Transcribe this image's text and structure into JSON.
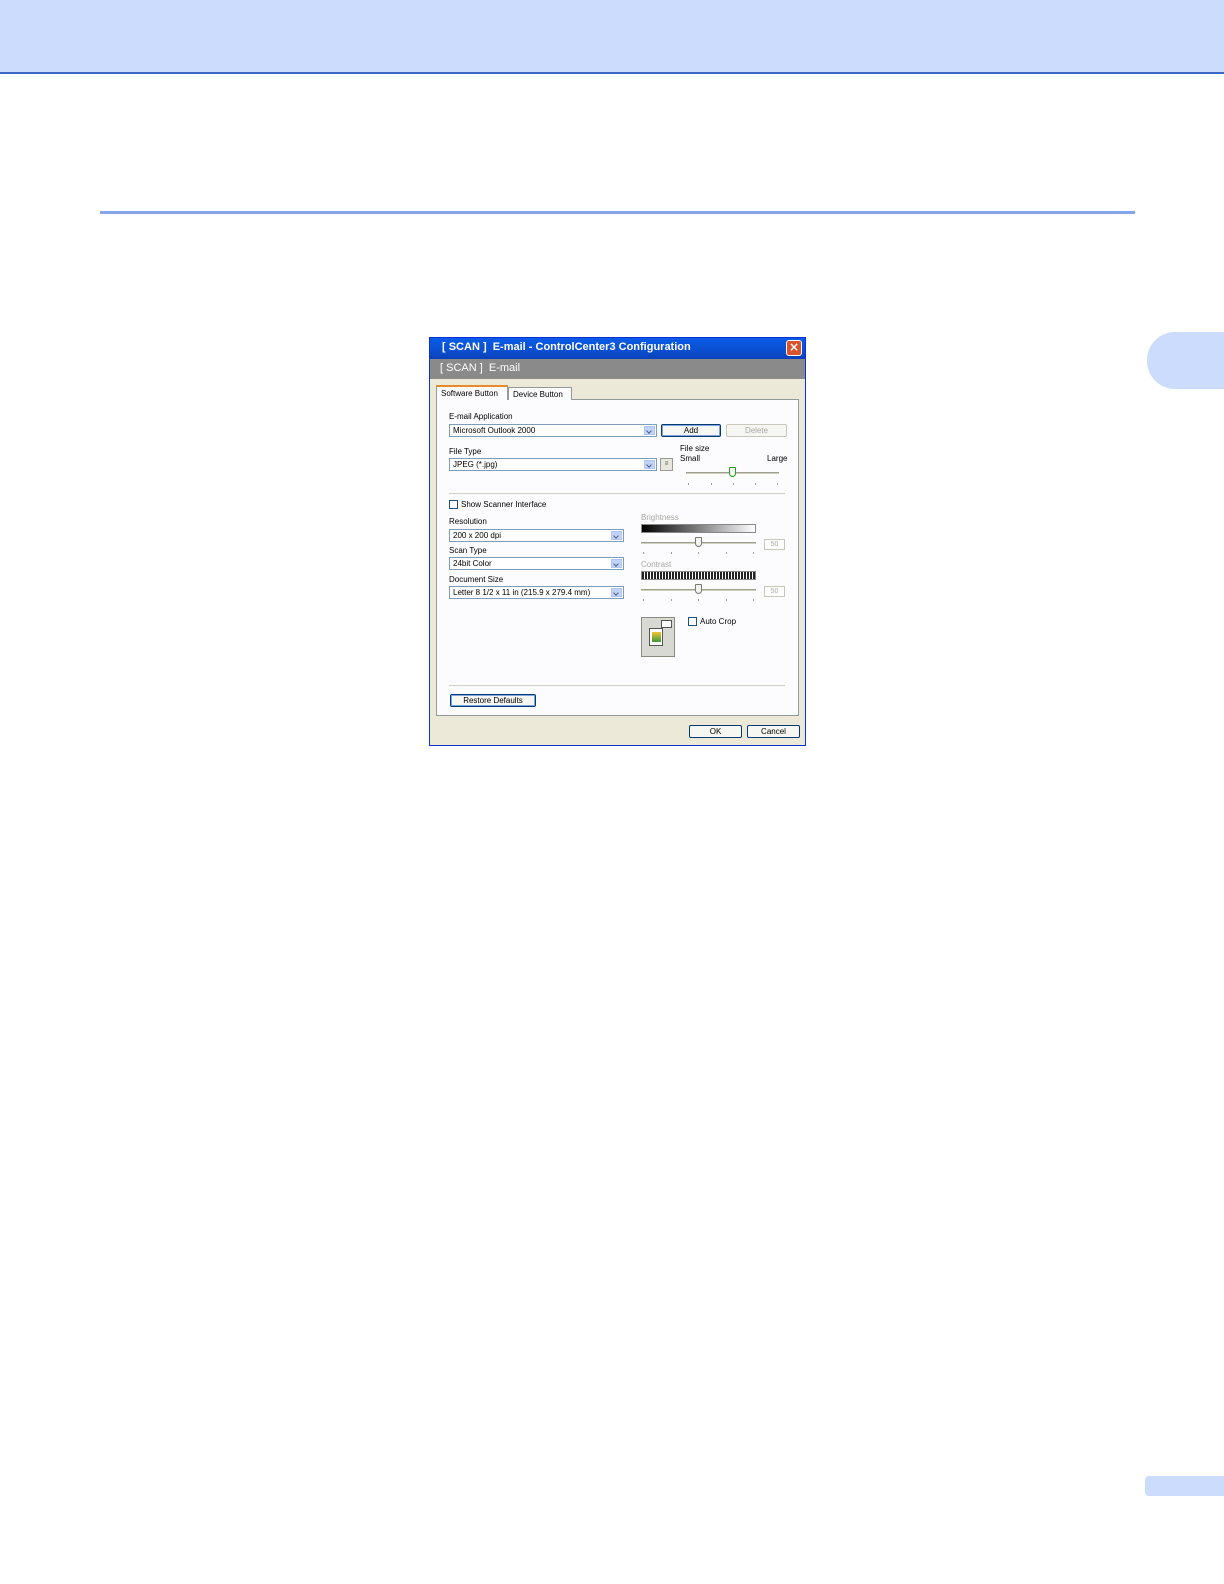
{
  "dialog": {
    "title": "[ SCAN ]  E-mail - ControlCenter3 Configuration",
    "close_glyph": "×",
    "banner_text": "[ SCAN ]  E-mail"
  },
  "tabs": [
    {
      "label": "Software Button",
      "active": true
    },
    {
      "label": "Device Button",
      "active": false
    }
  ],
  "email_application": {
    "label": "E-mail Application",
    "selected": "Microsoft Outlook 2000",
    "add_label": "Add",
    "delete_label": "Delete"
  },
  "file_type": {
    "label": "File Type",
    "selected": "JPEG (*.jpg)",
    "settings_glyph": "≡"
  },
  "file_size": {
    "label": "File size",
    "small_label": "Small",
    "large_label": "Large",
    "level_fraction": 0.5
  },
  "show_scanner_interface": {
    "label": "Show Scanner Interface",
    "checked": false
  },
  "resolution": {
    "label": "Resolution",
    "selected": "200 x 200 dpi"
  },
  "scan_type": {
    "label": "Scan Type",
    "selected": "24bit Color"
  },
  "document_size": {
    "label": "Document Size",
    "selected": "Letter 8 1/2 x 11 in (215.9 x 279.4 mm)"
  },
  "brightness": {
    "label": "Brightness",
    "value": "50",
    "level_fraction": 0.5
  },
  "contrast": {
    "label": "Contrast",
    "value": "50",
    "level_fraction": 0.5
  },
  "auto_crop": {
    "label": "Auto Crop",
    "checked": false
  },
  "buttons": {
    "restore_defaults": "Restore Defaults",
    "ok": "OK",
    "cancel": "Cancel"
  },
  "colors": {
    "page_band": "#ccdcfc",
    "titlebar": "#0b4fd0",
    "banner": "#8a8a8a",
    "dialog_face": "#ece9d8"
  }
}
